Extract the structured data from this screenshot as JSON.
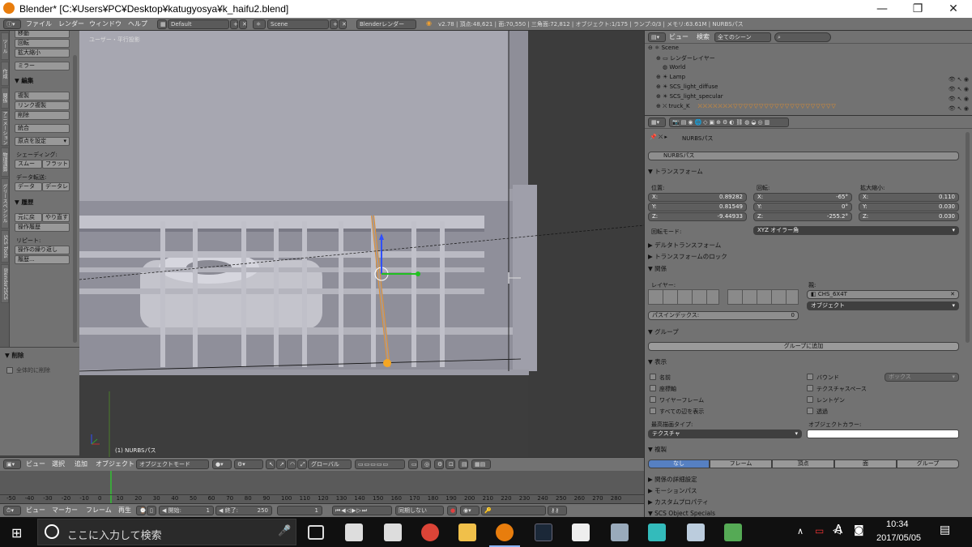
{
  "window": {
    "title": "Blender* [C:¥Users¥PC¥Desktop¥katugyosya¥k_haifu2.blend]",
    "min": "—",
    "max": "❐",
    "close": "✕"
  },
  "menubar": {
    "items": [
      "ファイル",
      "レンダー",
      "ウィンドウ",
      "ヘルプ"
    ],
    "layout": "Default",
    "scene": "Scene",
    "engine": "Blenderレンダー",
    "stats": "v2.78 | 頂点:48,621 | 面:70,550 | 三角面:72,812 | オブジェクト:1/175 | ランプ:0/3 | メモリ:63.61M | NURBSパス"
  },
  "toolshelf": {
    "tabs": [
      "ツール",
      "作成",
      "関係",
      "アニメーション",
      "物理演算",
      "グリースペンシル",
      "SCS Tools",
      "Blender2SCS"
    ],
    "transform": [
      "移動",
      "回転",
      "拡大縮小"
    ],
    "mirror": "ミラー",
    "edit_header": "▼ 編集",
    "edit": [
      "複製",
      "リンク複製",
      "削除"
    ],
    "join": "統合",
    "origin": "原点を設定",
    "shading_label": "シェーディング:",
    "smooth": "スムー",
    "flat": "フラット",
    "data_label": "データ転送:",
    "data1": "データ",
    "data2": "データレ",
    "history_header": "▼ 履歴",
    "undo": "元に戻",
    "redo": "やり直す",
    "undo_history": "操作履歴",
    "repeat_label": "リピート:",
    "repeat_last": "操作の繰り返し",
    "repeat_history": "履歴..."
  },
  "operator": {
    "header": "▼ 削除",
    "global": "全体的に削除"
  },
  "viewport": {
    "label": "ユーザー・平行投影",
    "object": "(1) NURBSパス"
  },
  "vpheader": {
    "items": [
      "ビュー",
      "選択",
      "追加",
      "オブジェクト"
    ],
    "mode": "オブジェクトモード",
    "orient": "グローバル"
  },
  "timeline": {
    "ticks": [
      "-50",
      "-40",
      "-30",
      "-20",
      "-10",
      "0",
      "10",
      "20",
      "30",
      "40",
      "50",
      "60",
      "70",
      "80",
      "90",
      "100",
      "110",
      "120",
      "130",
      "140",
      "150",
      "160",
      "170",
      "180",
      "190",
      "200",
      "210",
      "220",
      "230",
      "240",
      "250",
      "260",
      "270",
      "280"
    ]
  },
  "tlheader": {
    "items": [
      "ビュー",
      "マーカー",
      "フレーム",
      "再生"
    ],
    "start_label": "◀ 開始:",
    "start": "1",
    "end_label": "◀ 終了:",
    "end": "250",
    "current": "1",
    "sync": "同期しない"
  },
  "outliner": {
    "items": [
      "ビュー",
      "検索"
    ],
    "filter": "全てのシーン",
    "rows": [
      "Scene",
      "レンダーレイヤー",
      "World",
      "Lamp",
      "SCS_light_diffuse",
      "SCS_light_specular",
      "truck_K"
    ]
  },
  "props": {
    "breadcrumb": "NURBSパス",
    "name": "NURBSパス",
    "transform_header": "▼ トランスフォーム",
    "loc_label": "位置:",
    "rot_label": "回転:",
    "scale_label": "拡大縮小:",
    "loc": [
      {
        "k": "X:",
        "v": "0.89282"
      },
      {
        "k": "Y:",
        "v": "0.81549"
      },
      {
        "k": "Z:",
        "v": "-9.44933"
      }
    ],
    "rot": [
      {
        "k": "X:",
        "v": "-65°"
      },
      {
        "k": "Y:",
        "v": "0°"
      },
      {
        "k": "Z:",
        "v": "-255.2°"
      }
    ],
    "scale": [
      {
        "k": "X:",
        "v": "0.110"
      },
      {
        "k": "Y:",
        "v": "0.030"
      },
      {
        "k": "Z:",
        "v": "0.030"
      }
    ],
    "rotmode_label": "回転モード:",
    "rotmode": "XYZ オイラー角",
    "delta": "▶ デルタトランスフォーム",
    "lock": "▶ トランスフォームのロック",
    "relations": "▼ 関係",
    "layer_label": "レイヤー:",
    "parent_label": "親:",
    "parent": "CHS_6X4T",
    "parent_type": "オブジェクト",
    "pass_index": "パスインデックス:",
    "pass_value": "0",
    "groups": "▼ グループ",
    "add_group": "グループに追加",
    "display": "▼ 表示",
    "disp_left": [
      "名前",
      "座標軸",
      "ワイヤーフレーム",
      "すべての辺を表示"
    ],
    "disp_right": [
      "バウンド",
      "テクスチャスペース",
      "レントゲン",
      "透過"
    ],
    "bounds_type": "ボックス",
    "maxdraw_label": "最高描画タイプ:",
    "maxdraw": "テクスチャ",
    "objcolor_label": "オブジェクトカラー:",
    "dup": "▼ 複製",
    "dup_opts": [
      "なし",
      "フレーム",
      "頂点",
      "面",
      "グループ"
    ],
    "rel_extras": "▶ 関係の詳細設定",
    "motion": "▶ モーションパス",
    "custom": "▶ カスタムプロパティ",
    "scs": "▼ SCS Object Specials"
  },
  "taskbar": {
    "search": "ここに入力して検索",
    "time": "10:34",
    "date": "2017/05/05",
    "ime": "A"
  }
}
